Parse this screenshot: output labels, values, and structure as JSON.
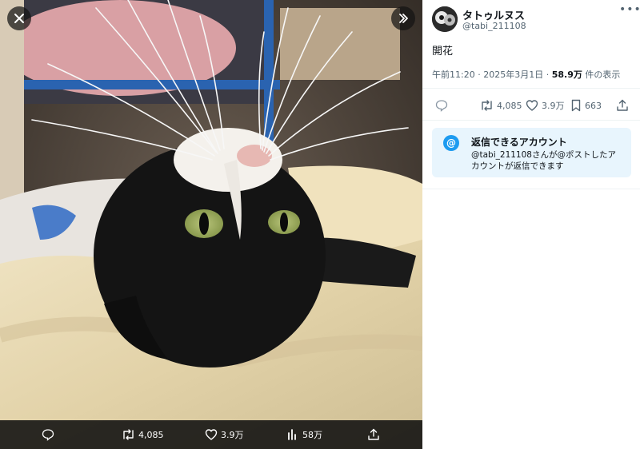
{
  "media": {
    "stats": {
      "replies": "",
      "retweets": "4,085",
      "likes": "3.9万",
      "views": "58万"
    }
  },
  "author": {
    "name": "タトゥルヌス",
    "handle": "@tabi_211108"
  },
  "post": {
    "text": "開花",
    "time": "午前11:20",
    "separator": " · ",
    "date": "2025年3月1日",
    "views_count": "58.9万",
    "views_label": " 件の表示"
  },
  "actions": {
    "replies": "",
    "retweets": "4,085",
    "likes": "3.9万",
    "bookmarks": "663"
  },
  "reply_notice": {
    "title": "返信できるアカウント",
    "body": "@tabi_211108さんが@ポストしたアカウントが返信できます"
  },
  "colors": {
    "accent": "#1d9bf0",
    "notice_bg": "#e8f5fd",
    "muted_text": "#536471"
  }
}
